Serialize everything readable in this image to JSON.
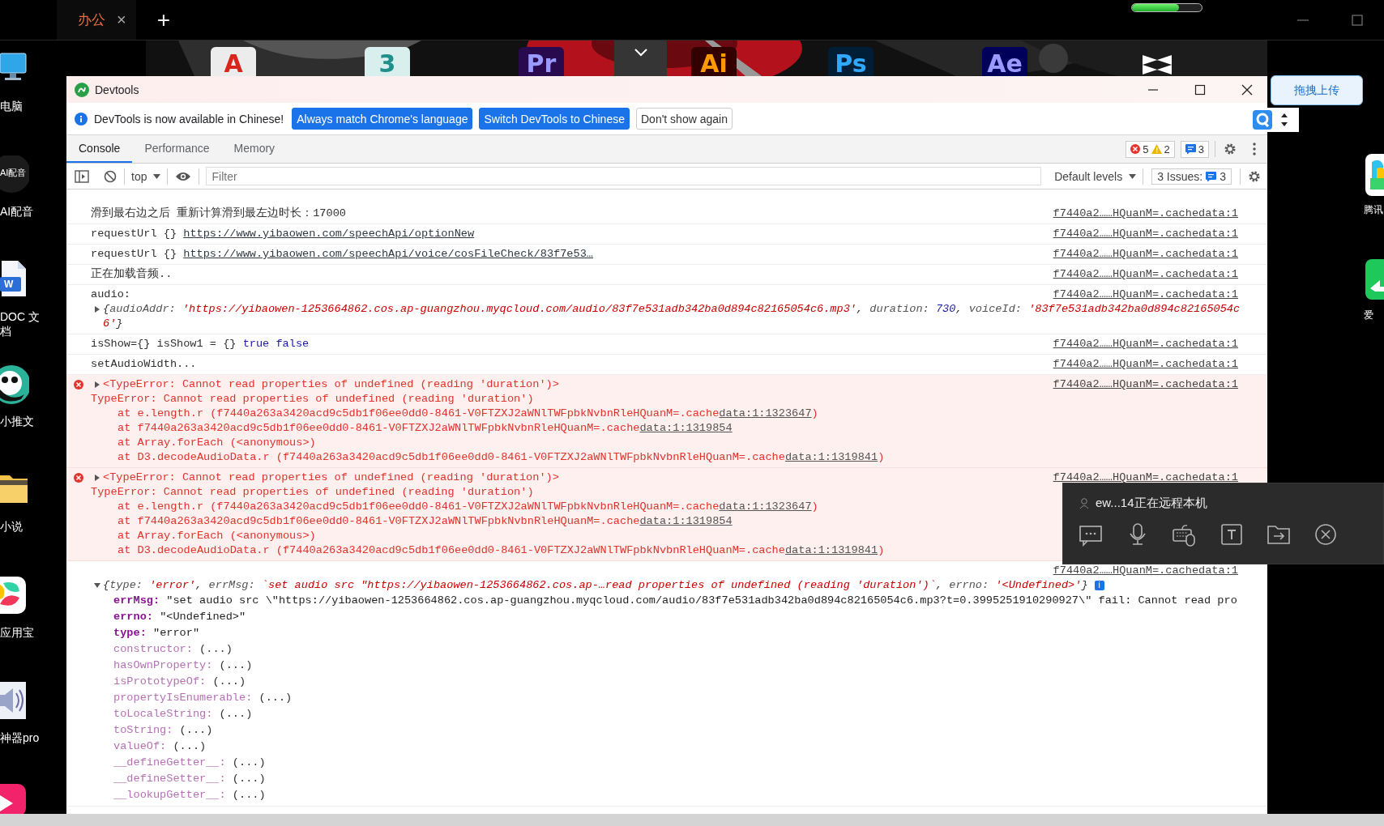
{
  "taskbar": {
    "tabs": [
      {
        "label": "办公",
        "selected": true,
        "close": "×"
      }
    ],
    "new_tab": "+",
    "meter": {
      "level": 0.68
    }
  },
  "dock": [
    {
      "kind": "letter",
      "label": "A"
    },
    {
      "kind": "letter",
      "label": "3"
    },
    {
      "kind": "letter",
      "label": "Pr"
    },
    {
      "kind": "toggle"
    },
    {
      "kind": "letter",
      "label": "Ai"
    },
    {
      "kind": "letter",
      "label": "Ps"
    },
    {
      "kind": "letter",
      "label": "Ae"
    },
    {
      "kind": "mark"
    }
  ],
  "desktop": {
    "left": [
      {
        "kind": "monitor",
        "label": "电脑"
      },
      {
        "kind": "ai",
        "badge": "AI配音",
        "label": "AI配音"
      },
      {
        "kind": "doc",
        "badge": "W",
        "label": "DOC 文档"
      },
      {
        "kind": "panda",
        "label": "小推文"
      },
      {
        "kind": "folder",
        "label": "小说"
      },
      {
        "kind": "store",
        "label": "应用宝"
      },
      {
        "kind": "speaker",
        "label": "神器pro"
      },
      {
        "kind": "pink"
      }
    ],
    "right": [
      {
        "kind": "colorful",
        "label": "腾讯"
      },
      {
        "kind": "green",
        "label": "爱"
      }
    ]
  },
  "upload_button": "拖拽上传",
  "devtools": {
    "title": "Devtools",
    "banner": {
      "message": "DevTools is now available in Chinese!",
      "buttons": [
        {
          "label": "Always match Chrome's language",
          "kind": "primary"
        },
        {
          "label": "Switch DevTools to Chinese",
          "kind": "primary"
        },
        {
          "label": "Don't show again",
          "kind": "secondary"
        }
      ]
    },
    "tabs": [
      {
        "label": "Console",
        "selected": true
      },
      {
        "label": "Performance",
        "selected": false
      },
      {
        "label": "Memory",
        "selected": false
      }
    ],
    "counters": {
      "errors": "5",
      "warnings": "2",
      "messages": "3"
    },
    "toolbar": {
      "context": "top",
      "filter": {
        "placeholder": "Filter"
      },
      "levels": "Default levels",
      "issues": {
        "label": "3 Issues:",
        "count": "3"
      }
    },
    "console": [
      {
        "kind": "log",
        "parts": [
          {
            "kind": "plain",
            "text": "滑到最右边之后 重新计算滑到最左边时长：17000"
          }
        ],
        "source": "f7440a2……HQuanM=.cachedata:1"
      },
      {
        "kind": "log",
        "parts": [
          {
            "kind": "plain",
            "text": "requestUrl {} "
          },
          {
            "kind": "link",
            "text": "https://www.yibaowen.com/speechApi/optionNew"
          }
        ],
        "source": "f7440a2……HQuanM=.cachedata:1"
      },
      {
        "kind": "log",
        "parts": [
          {
            "kind": "plain",
            "text": "requestUrl {} "
          },
          {
            "kind": "link",
            "text": "https://www.yibaowen.com/speechApi/voice/cosFileCheck/83f7e53…"
          }
        ],
        "source": "f7440a2……HQuanM=.cachedata:1"
      },
      {
        "kind": "log",
        "parts": [
          {
            "kind": "plain",
            "text": "正在加载音频.."
          }
        ],
        "source": "f7440a2……HQuanM=.cachedata:1"
      },
      {
        "kind": "object",
        "label": "audio:",
        "expanded": false,
        "source": "f7440a2……HQuanM=.cachedata:1",
        "preview": [
          {
            "kind": "punct",
            "text": "{"
          },
          {
            "kind": "key",
            "text": "audioAddr: "
          },
          {
            "kind": "string",
            "text": "'https://yibaowen-1253664862.cos.ap-guangzhou.myqcloud.com/audio/83f7e531adb342ba0d894c82165054c6.mp3'"
          },
          {
            "kind": "punct",
            "text": ", "
          },
          {
            "kind": "key",
            "text": "duration: "
          },
          {
            "kind": "number",
            "text": "730"
          },
          {
            "kind": "punct",
            "text": ", "
          },
          {
            "kind": "key",
            "text": "voiceId: "
          },
          {
            "kind": "string",
            "text": "'83f7e531adb342ba0d894c82165054c6'"
          },
          {
            "kind": "punct",
            "text": "}"
          }
        ]
      },
      {
        "kind": "log",
        "parts": [
          {
            "kind": "plain",
            "text": "isShow={} isShow1 = {} "
          },
          {
            "kind": "keyword",
            "text": "true false"
          }
        ],
        "source": "f7440a2……HQuanM=.cachedata:1"
      },
      {
        "kind": "log",
        "parts": [
          {
            "kind": "plain",
            "text": "setAudioWidth..."
          }
        ],
        "source": "f7440a2……HQuanM=.cachedata:1"
      },
      {
        "kind": "error",
        "summary": "<TypeError: Cannot read properties of undefined (reading 'duration')>",
        "expanded": false,
        "message": "TypeError: Cannot read properties of undefined (reading 'duration')",
        "source": "f7440a2……HQuanM=.cachedata:1",
        "frames": [
          {
            "text": "at e.length.r (f7440a263a3420acd9c5db1f06ee0dd0-8461-V0FTZXJ2aWNlTWFpbkNvbnRleHQuanM=.cache",
            "link": "data:1:1323647",
            "tail": ")"
          },
          {
            "text": "at f7440a263a3420acd9c5db1f06ee0dd0-8461-V0FTZXJ2aWNlTWFpbkNvbnRleHQuanM=.cache",
            "link": "data:1:1319854"
          },
          {
            "text": "at Array.forEach (<anonymous>)"
          },
          {
            "text": "at D3.decodeAudioData.r (f7440a263a3420acd9c5db1f06ee0dd0-8461-V0FTZXJ2aWNlTWFpbkNvbnRleHQuanM=.cache",
            "link": "data:1:1319841",
            "tail": ")"
          }
        ]
      },
      {
        "kind": "error",
        "summary": "<TypeError: Cannot read properties of undefined (reading 'duration')>",
        "expanded": false,
        "message": "TypeError: Cannot read properties of undefined (reading 'duration')",
        "source": "f7440a2……HQuanM=.cachedata:1",
        "frames": [
          {
            "text": "at e.length.r (f7440a263a3420acd9c5db1f06ee0dd0-8461-V0FTZXJ2aWNlTWFpbkNvbnRleHQuanM=.cache",
            "link": "data:1:1323647",
            "tail": ")"
          },
          {
            "text": "at f7440a263a3420acd9c5db1f06ee0dd0-8461-V0FTZXJ2aWNlTWFpbkNvbnRleHQuanM=.cache",
            "link": "data:1:1319854"
          },
          {
            "text": "at Array.forEach (<anonymous>)"
          },
          {
            "text": "at D3.decodeAudioData.r (f7440a263a3420acd9c5db1f06ee0dd0-8461-V0FTZXJ2aWNlTWFpbkNvbnRleHQuanM=.cache",
            "link": "data:1:1319841",
            "tail": ")"
          }
        ]
      },
      {
        "kind": "object",
        "expanded": true,
        "source": "f7440a2……HQuanM=.cachedata:1",
        "info": "i",
        "preview": [
          {
            "kind": "punct",
            "text": "{"
          },
          {
            "kind": "key",
            "text": "type: "
          },
          {
            "kind": "string",
            "text": "'error'"
          },
          {
            "kind": "punct",
            "text": ", "
          },
          {
            "kind": "key",
            "text": "errMsg: "
          },
          {
            "kind": "string",
            "text": "`set audio src \"https://yibaowen-1253664862.cos.ap-…read properties of undefined (reading 'duration')`"
          },
          {
            "kind": "punct",
            "text": ", "
          },
          {
            "kind": "key",
            "text": "errno: "
          },
          {
            "kind": "string",
            "text": "'<Undefined>'"
          },
          {
            "kind": "punct",
            "text": "}"
          }
        ],
        "properties": [
          {
            "key": "errMsg:",
            "value": "\"set audio src \\\"https://yibaowen-1253664862.cos.ap-guangzhou.myqcloud.com/audio/83f7e531adb342ba0d894c82165054c6.mp3?t=0.3995251910290927\\\" fail: Cannot read pro",
            "own": true
          },
          {
            "key": "errno:",
            "value": "\"<Undefined>\"",
            "own": true
          },
          {
            "key": "type:",
            "value": "\"error\"",
            "own": true
          },
          {
            "key": "constructor:",
            "value": "(...)",
            "own": false
          },
          {
            "key": "hasOwnProperty:",
            "value": "(...)",
            "own": false
          },
          {
            "key": "isPrototypeOf:",
            "value": "(...)",
            "own": false
          },
          {
            "key": "propertyIsEnumerable:",
            "value": "(...)",
            "own": false
          },
          {
            "key": "toLocaleString:",
            "value": "(...)",
            "own": false
          },
          {
            "key": "toString:",
            "value": "(...)",
            "own": false
          },
          {
            "key": "valueOf:",
            "value": "(...)",
            "own": false
          },
          {
            "key": "__defineGetter__:",
            "value": "(...)",
            "own": false
          },
          {
            "key": "__defineSetter__:",
            "value": "(...)",
            "own": false
          },
          {
            "key": "__lookupGetter__:",
            "value": "(...)",
            "own": false
          }
        ]
      }
    ]
  },
  "remote_panel": {
    "text": "ew...14正在远程本机"
  }
}
